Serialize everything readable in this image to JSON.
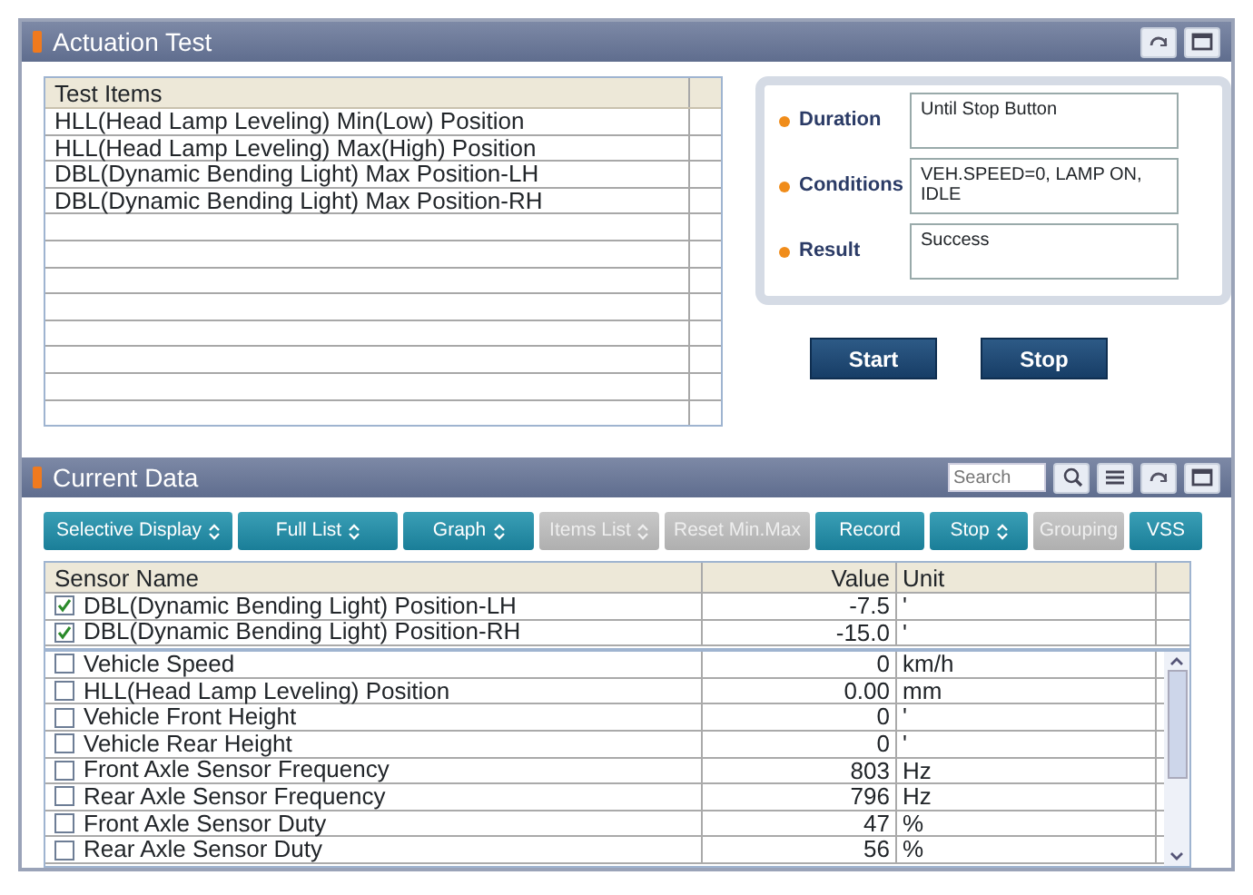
{
  "actuation_panel": {
    "title": "Actuation Test",
    "test_items": {
      "column": "Test Items",
      "rows": [
        {
          "label": "HLL(Head Lamp Leveling) Min(Low) Position"
        },
        {
          "label": "HLL(Head Lamp Leveling) Max(High) Position"
        },
        {
          "label": "DBL(Dynamic Bending Light) Max Position-LH"
        },
        {
          "label": "DBL(Dynamic Bending Light) Max Position-RH"
        }
      ]
    },
    "info": [
      {
        "label": "Duration",
        "value": "Until Stop Button"
      },
      {
        "label": "Conditions",
        "value": "VEH.SPEED=0, LAMP ON, IDLE"
      },
      {
        "label": "Result",
        "value": "Success"
      }
    ],
    "buttons": [
      "Start",
      "Stop"
    ]
  },
  "current_data": {
    "title": "Current Data",
    "search": {
      "placeholder": "Search"
    },
    "toolbar": [
      {
        "label": "Selective Display",
        "kind": "dropdown",
        "disabled": false
      },
      {
        "label": "Full List",
        "kind": "dropdown",
        "disabled": false
      },
      {
        "label": "Graph",
        "kind": "dropdown",
        "disabled": false
      },
      {
        "label": "Items List",
        "kind": "dropdown",
        "disabled": true
      },
      {
        "label": "Reset Min.Max",
        "kind": "button",
        "disabled": true
      },
      {
        "label": "Record",
        "kind": "button",
        "disabled": false
      },
      {
        "label": "Stop",
        "kind": "dropdown",
        "disabled": false
      },
      {
        "label": "Grouping",
        "kind": "button",
        "disabled": true
      },
      {
        "label": "VSS",
        "kind": "button",
        "disabled": false
      }
    ],
    "columns": [
      "Sensor Name",
      "Value",
      "Unit"
    ],
    "pinned_rows": [
      {
        "name": "DBL(Dynamic Bending Light) Position-LH",
        "value": "-7.5",
        "unit": "'",
        "checked": true
      },
      {
        "name": "DBL(Dynamic Bending Light) Position-RH",
        "value": "-15.0",
        "unit": "'",
        "checked": true
      }
    ],
    "rows": [
      {
        "name": "Vehicle Speed",
        "value": "0",
        "unit": "km/h",
        "checked": false
      },
      {
        "name": "HLL(Head Lamp Leveling) Position",
        "value": "0.00",
        "unit": "mm",
        "checked": false
      },
      {
        "name": "Vehicle Front Height",
        "value": "0",
        "unit": "'",
        "checked": false
      },
      {
        "name": "Vehicle Rear Height",
        "value": "0",
        "unit": "'",
        "checked": false
      },
      {
        "name": "Front Axle Sensor Frequency",
        "value": "803",
        "unit": "Hz",
        "checked": false
      },
      {
        "name": "Rear Axle Sensor Frequency",
        "value": "796",
        "unit": "Hz",
        "checked": false
      },
      {
        "name": "Front Axle Sensor Duty",
        "value": "47",
        "unit": "%",
        "checked": false
      },
      {
        "name": "Rear Axle Sensor Duty",
        "value": "56",
        "unit": "%",
        "checked": false
      }
    ]
  }
}
